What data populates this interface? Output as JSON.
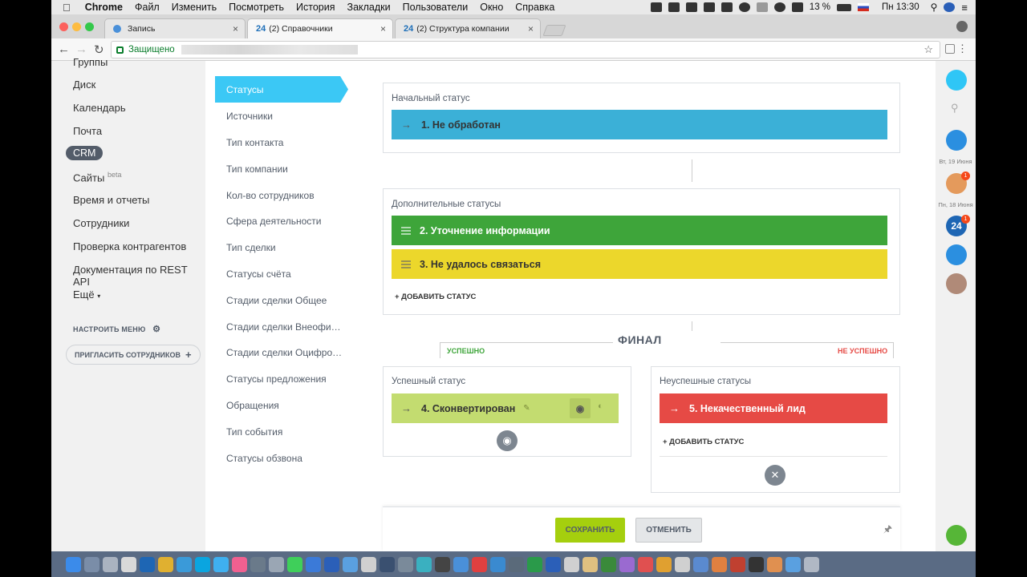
{
  "menubar": {
    "apple": "",
    "items": [
      "Chrome",
      "Файл",
      "Изменить",
      "Посмотреть",
      "История",
      "Закладки",
      "Пользователи",
      "Окно",
      "Справка"
    ],
    "battery": "13 %",
    "clock": "Пн 13:30"
  },
  "browser": {
    "tabs": [
      {
        "icon": "",
        "label": "Запись"
      },
      {
        "icon": "24",
        "label": "(2) Справочники"
      },
      {
        "icon": "24",
        "label": "(2) Структура компании"
      }
    ],
    "secure_label": "Защищено",
    "close_glyph": "×"
  },
  "left_menu": {
    "items": [
      "Группы",
      "Диск",
      "Календарь",
      "Почта",
      "CRM",
      "Сайты",
      "Время и отчеты",
      "Сотрудники",
      "Проверка контрагентов",
      "Документация по REST API",
      "Ещё"
    ],
    "beta": "beta",
    "more_arrow": "▾",
    "configure": "НАСТРОИТЬ МЕНЮ",
    "invite": "ПРИГЛАСИТЬ СОТРУДНИКОВ",
    "plus": "+"
  },
  "submenu": {
    "active": "Статусы",
    "items": [
      "Источники",
      "Тип контакта",
      "Тип компании",
      "Кол-во сотрудников",
      "Сфера деятельности",
      "Тип сделки",
      "Статусы счёта",
      "Стадии сделки Общее",
      "Стадии сделки Внеофи…",
      "Стадии сделки Оцифро…",
      "Статусы предложения",
      "Обращения",
      "Тип события",
      "Статусы обзвона"
    ]
  },
  "statuses": {
    "initial_title": "Начальный статус",
    "initial": "1. Не обработан",
    "additional_title": "Дополнительные статусы",
    "additional": [
      "2. Уточнение информации",
      "3. Не удалось связаться"
    ],
    "add_status": "+ ДОБАВИТЬ СТАТУС",
    "final": "ФИНАЛ",
    "success_label": "УСПЕШНО",
    "fail_label": "НЕ УСПЕШНО",
    "success_title": "Успешный статус",
    "success": "4. Сконвертирован",
    "fail_title": "Неуспешные статусы",
    "fail": "5. Некачественный лид",
    "arrow": "→"
  },
  "buttons": {
    "save": "СОХРАНИТЬ",
    "cancel": "ОТМЕНИТЬ"
  },
  "right_panel": {
    "date1": "Вт, 19 Июня",
    "date2": "Пн, 18 Июня",
    "badge": "1",
    "logo24": "24"
  },
  "colors": {
    "initial": "#3bb0d7",
    "green": "#3ea53a",
    "yellow": "#ecd72b",
    "success": "#c3dc70",
    "fail": "#e64a45",
    "active_tab": "#3bc8f5",
    "save": "#a5cf0e"
  }
}
